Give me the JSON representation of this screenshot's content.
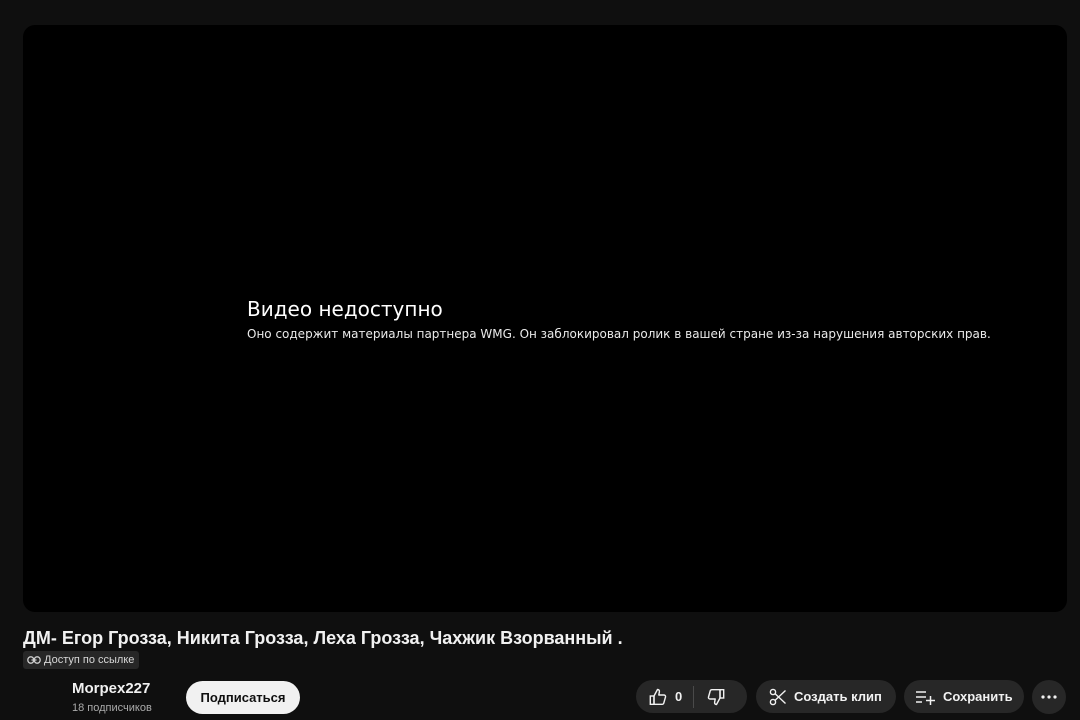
{
  "player": {
    "error_title": "Видео недоступно",
    "error_message": "Оно содержит материалы партнера WMG. Он заблокировал ролик в вашей стране из-за нарушения авторских прав."
  },
  "video": {
    "title": "ДМ- Егор Грозза, Никита Грозза, Леха Грозза, Чахжик Взорванный .",
    "access_label": "Доступ по ссылке"
  },
  "channel": {
    "name": "Morpex227",
    "subscribers": "18 подписчиков",
    "subscribe_label": "Подписаться"
  },
  "actions": {
    "like_count": "0",
    "clip_label": "Создать клип",
    "save_label": "Сохранить"
  },
  "icons": {
    "access": "link-icon",
    "like": "thumbs-up-icon",
    "dislike": "thumbs-down-icon",
    "clip": "scissors-icon",
    "save": "playlist-add-icon",
    "more": "more-horizontal-icon"
  }
}
